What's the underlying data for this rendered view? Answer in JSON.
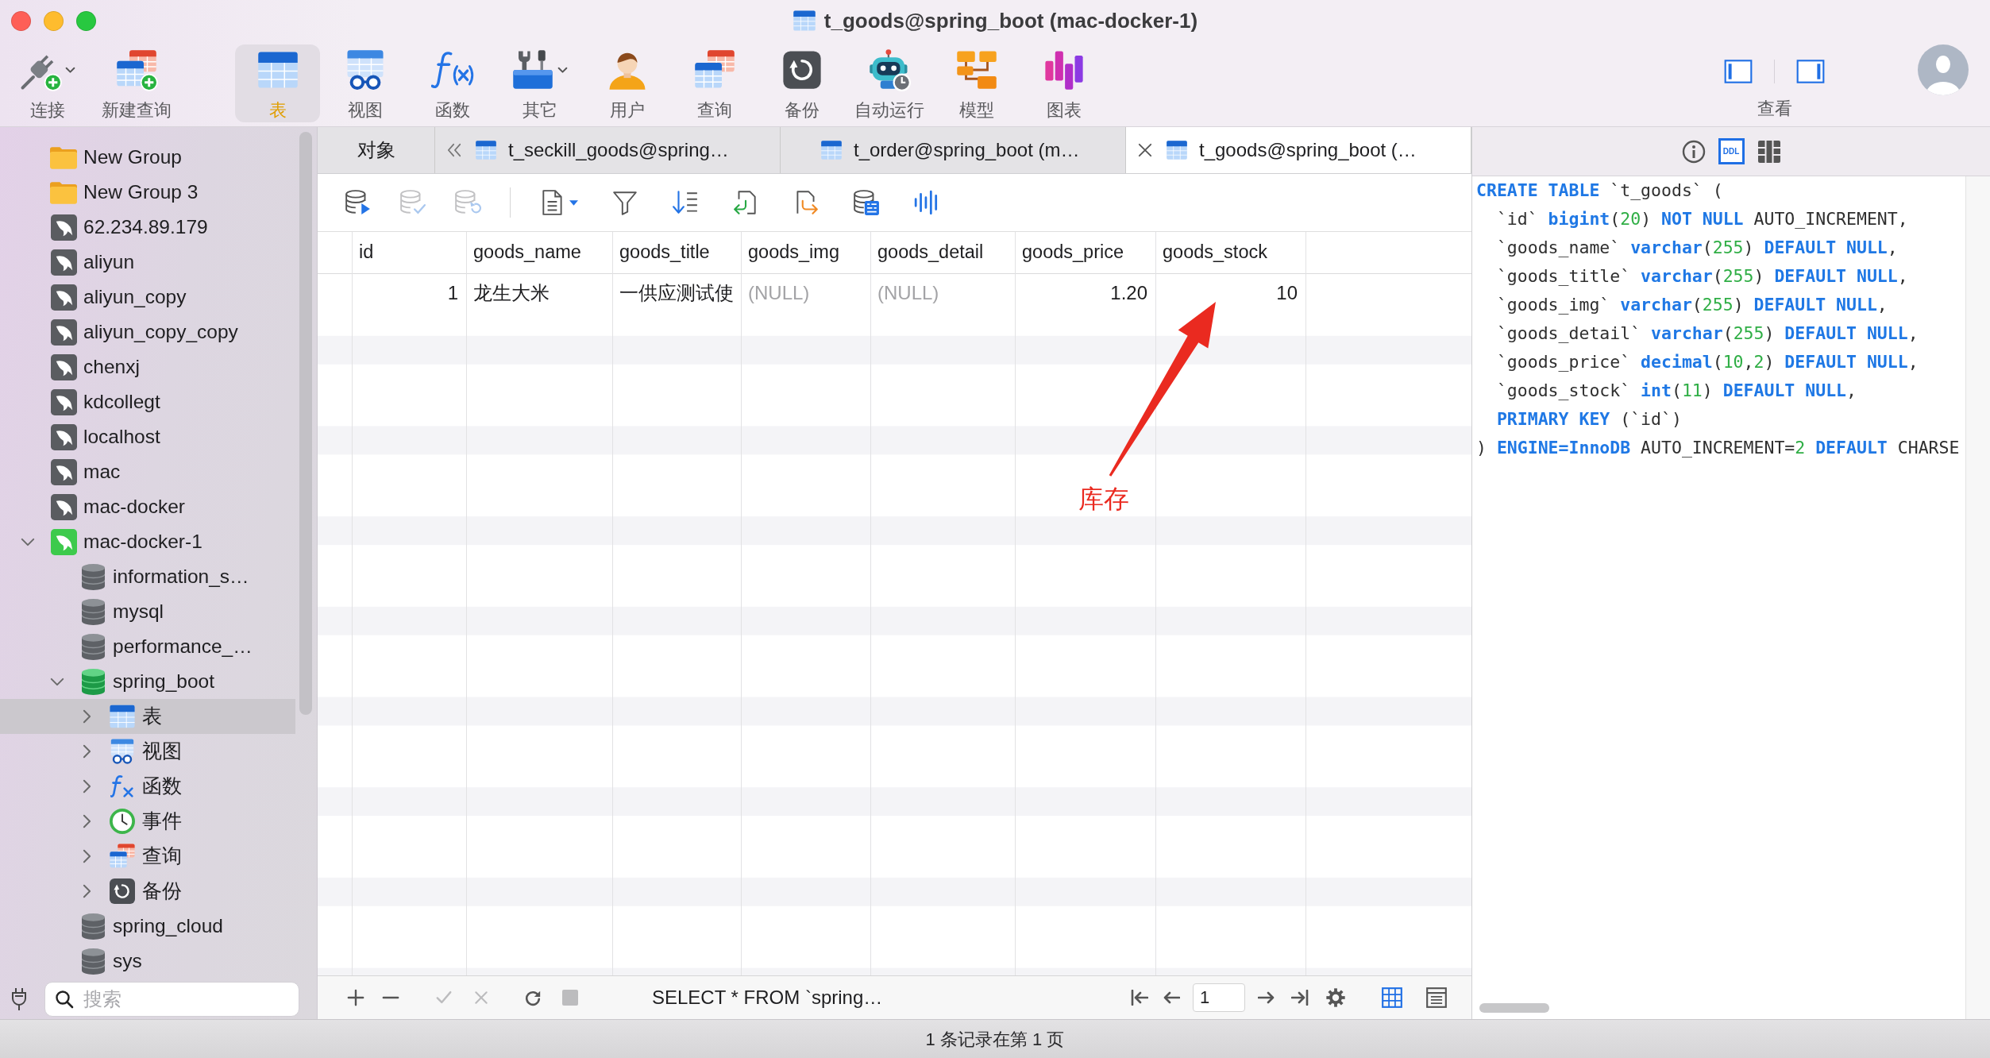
{
  "window": {
    "title": "t_goods@spring_boot (mac-docker-1)"
  },
  "toolbar": {
    "groups": [
      {
        "items": [
          {
            "label": "连接",
            "dropdown": true,
            "selected": false
          },
          {
            "label": "新建查询",
            "dropdown": false,
            "selected": false
          }
        ]
      },
      {
        "items": [
          {
            "label": "表",
            "dropdown": false,
            "selected": true
          },
          {
            "label": "视图",
            "dropdown": false,
            "selected": false
          },
          {
            "label": "函数",
            "dropdown": false,
            "selected": false
          },
          {
            "label": "其它",
            "dropdown": true,
            "selected": false
          },
          {
            "label": "用户",
            "dropdown": false,
            "selected": false
          },
          {
            "label": "查询",
            "dropdown": false,
            "selected": false
          },
          {
            "label": "备份",
            "dropdown": false,
            "selected": false
          },
          {
            "label": "自动运行",
            "dropdown": false,
            "selected": false
          },
          {
            "label": "模型",
            "dropdown": false,
            "selected": false
          },
          {
            "label": "图表",
            "dropdown": false,
            "selected": false
          }
        ]
      }
    ],
    "view": {
      "label": "查看",
      "panes": [
        {
          "on": true
        },
        {
          "on": true
        }
      ]
    }
  },
  "sidebar": {
    "items": [
      {
        "label": "New Group",
        "kind": "group",
        "selected": false
      },
      {
        "label": "New Group 3",
        "kind": "group",
        "selected": false
      },
      {
        "label": "62.234.89.179",
        "kind": "connection",
        "open": false,
        "selected": false
      },
      {
        "label": "aliyun",
        "kind": "connection",
        "open": false,
        "selected": false
      },
      {
        "label": "aliyun_copy",
        "kind": "connection",
        "open": false,
        "selected": false
      },
      {
        "label": "aliyun_copy_copy",
        "kind": "connection",
        "open": false,
        "selected": false
      },
      {
        "label": "chenxj",
        "kind": "connection",
        "open": false,
        "selected": false
      },
      {
        "label": "kdcollegt",
        "kind": "connection",
        "open": false,
        "selected": false
      },
      {
        "label": "localhost",
        "kind": "connection",
        "open": false,
        "selected": false
      },
      {
        "label": "mac",
        "kind": "connection",
        "open": false,
        "selected": false
      },
      {
        "label": "mac-docker",
        "kind": "connection",
        "open": false,
        "selected": false
      },
      {
        "label": "mac-docker-1",
        "kind": "connection",
        "open": true,
        "expanded": true,
        "selected": false,
        "children": [
          {
            "label": "information_s…",
            "kind": "database",
            "open": false,
            "selected": false
          },
          {
            "label": "mysql",
            "kind": "database",
            "open": false,
            "selected": false
          },
          {
            "label": "performance_…",
            "kind": "database",
            "open": false,
            "selected": false
          },
          {
            "label": "spring_boot",
            "kind": "database",
            "open": true,
            "expanded": true,
            "selected": false,
            "children": [
              {
                "label": "表",
                "kind": "tables",
                "expanded": false,
                "selected": true
              },
              {
                "label": "视图",
                "kind": "views",
                "expanded": false,
                "selected": false
              },
              {
                "label": "函数",
                "kind": "functions",
                "expanded": false,
                "selected": false
              },
              {
                "label": "事件",
                "kind": "events",
                "expanded": false,
                "selected": false
              },
              {
                "label": "查询",
                "kind": "queries",
                "expanded": false,
                "selected": false
              },
              {
                "label": "备份",
                "kind": "backups",
                "expanded": false,
                "selected": false
              }
            ]
          },
          {
            "label": "spring_cloud",
            "kind": "database",
            "open": false,
            "selected": false
          },
          {
            "label": "sys",
            "kind": "database",
            "open": false,
            "selected": false
          }
        ]
      }
    ],
    "search": {
      "placeholder": "搜索"
    }
  },
  "tabs": {
    "scrolled": true,
    "items": [
      {
        "label": "对象",
        "kind": "objects",
        "selected": false
      },
      {
        "label": "t_seckill_goods@spring…",
        "kind": "table",
        "selected": false
      },
      {
        "label": "t_order@spring_boot (m…",
        "kind": "table",
        "selected": false
      },
      {
        "label": "t_goods@spring_boot (…",
        "kind": "table",
        "selected": true
      }
    ]
  },
  "object_toolbar": {
    "buttons": [
      {
        "disabled": false
      },
      {
        "disabled": true
      },
      {
        "disabled": true
      },
      {
        "disabled": false
      },
      {
        "disabled": false
      },
      {
        "disabled": false
      },
      {
        "disabled": false
      },
      {
        "disabled": false
      },
      {
        "disabled": false
      },
      {
        "disabled": false
      }
    ]
  },
  "table": {
    "columns": [
      {
        "name": "id",
        "numeric": true
      },
      {
        "name": "goods_name",
        "numeric": false
      },
      {
        "name": "goods_title",
        "numeric": false
      },
      {
        "name": "goods_img",
        "numeric": false
      },
      {
        "name": "goods_detail",
        "numeric": false
      },
      {
        "name": "goods_price",
        "numeric": true
      },
      {
        "name": "goods_stock",
        "numeric": true
      }
    ],
    "rows": [
      {
        "cells": [
          {
            "text": "1",
            "null": false
          },
          {
            "text": "龙生大米",
            "null": false
          },
          {
            "text": "一供应测试使",
            "null": false
          },
          {
            "text": "(NULL)",
            "null": true
          },
          {
            "text": "(NULL)",
            "null": true
          },
          {
            "text": "1.20",
            "null": false
          },
          {
            "text": "10",
            "null": false
          }
        ]
      }
    ]
  },
  "annotation": {
    "text": "库存"
  },
  "table_footer": {
    "edit_buttons": [
      {
        "disabled": false
      },
      {
        "disabled": false
      },
      {
        "disabled": true
      },
      {
        "disabled": true
      },
      {
        "disabled": false
      },
      {
        "disabled": true
      }
    ],
    "query": "SELECT * FROM `spring…",
    "page": "1",
    "views": [
      {
        "selected": true
      },
      {
        "selected": false
      }
    ]
  },
  "ddl_panel": {
    "tabs": [
      {
        "selected": false
      },
      {
        "label": "DDL",
        "selected": true
      },
      {
        "selected": false
      }
    ],
    "lines": [
      [
        {
          "text": "CREATE TABLE",
          "kind": "keyword"
        },
        {
          "text": " `t_goods` (",
          "kind": "plain"
        }
      ],
      [
        {
          "text": "  `id` ",
          "kind": "plain"
        },
        {
          "text": "bigint",
          "kind": "keyword"
        },
        {
          "text": "(",
          "kind": "plain"
        },
        {
          "text": "20",
          "kind": "number"
        },
        {
          "text": ") ",
          "kind": "plain"
        },
        {
          "text": "NOT NULL",
          "kind": "keyword"
        },
        {
          "text": " AUTO_INCREMENT,",
          "kind": "plain"
        }
      ],
      [
        {
          "text": "  `goods_name` ",
          "kind": "plain"
        },
        {
          "text": "varchar",
          "kind": "keyword"
        },
        {
          "text": "(",
          "kind": "plain"
        },
        {
          "text": "255",
          "kind": "number"
        },
        {
          "text": ") ",
          "kind": "plain"
        },
        {
          "text": "DEFAULT NULL",
          "kind": "keyword"
        },
        {
          "text": ",",
          "kind": "plain"
        }
      ],
      [
        {
          "text": "  `goods_title` ",
          "kind": "plain"
        },
        {
          "text": "varchar",
          "kind": "keyword"
        },
        {
          "text": "(",
          "kind": "plain"
        },
        {
          "text": "255",
          "kind": "number"
        },
        {
          "text": ") ",
          "kind": "plain"
        },
        {
          "text": "DEFAULT NULL",
          "kind": "keyword"
        },
        {
          "text": ",",
          "kind": "plain"
        }
      ],
      [
        {
          "text": "  `goods_img` ",
          "kind": "plain"
        },
        {
          "text": "varchar",
          "kind": "keyword"
        },
        {
          "text": "(",
          "kind": "plain"
        },
        {
          "text": "255",
          "kind": "number"
        },
        {
          "text": ") ",
          "kind": "plain"
        },
        {
          "text": "DEFAULT NULL",
          "kind": "keyword"
        },
        {
          "text": ",",
          "kind": "plain"
        }
      ],
      [
        {
          "text": "  `goods_detail` ",
          "kind": "plain"
        },
        {
          "text": "varchar",
          "kind": "keyword"
        },
        {
          "text": "(",
          "kind": "plain"
        },
        {
          "text": "255",
          "kind": "number"
        },
        {
          "text": ") ",
          "kind": "plain"
        },
        {
          "text": "DEFAULT NULL",
          "kind": "keyword"
        },
        {
          "text": ",",
          "kind": "plain"
        }
      ],
      [
        {
          "text": "  `goods_price` ",
          "kind": "plain"
        },
        {
          "text": "decimal",
          "kind": "keyword"
        },
        {
          "text": "(",
          "kind": "plain"
        },
        {
          "text": "10",
          "kind": "number"
        },
        {
          "text": ",",
          "kind": "plain"
        },
        {
          "text": "2",
          "kind": "number"
        },
        {
          "text": ") ",
          "kind": "plain"
        },
        {
          "text": "DEFAULT NULL",
          "kind": "keyword"
        },
        {
          "text": ",",
          "kind": "plain"
        }
      ],
      [
        {
          "text": "  `goods_stock` ",
          "kind": "plain"
        },
        {
          "text": "int",
          "kind": "keyword"
        },
        {
          "text": "(",
          "kind": "plain"
        },
        {
          "text": "11",
          "kind": "number"
        },
        {
          "text": ") ",
          "kind": "plain"
        },
        {
          "text": "DEFAULT NULL",
          "kind": "keyword"
        },
        {
          "text": ",",
          "kind": "plain"
        }
      ],
      [
        {
          "text": "  PRIMARY KEY",
          "kind": "keyword"
        },
        {
          "text": " (`id`)",
          "kind": "plain"
        }
      ],
      [
        {
          "text": ") ",
          "kind": "plain"
        },
        {
          "text": "ENGINE=InnoDB",
          "kind": "keyword"
        },
        {
          "text": " AUTO_INCREMENT=",
          "kind": "plain"
        },
        {
          "text": "2",
          "kind": "number"
        },
        {
          "text": " DEFAULT",
          "kind": "keyword"
        },
        {
          "text": " CHARSE",
          "kind": "plain"
        }
      ]
    ]
  },
  "status_bar": {
    "text": "1 条记录在第 1 页"
  }
}
